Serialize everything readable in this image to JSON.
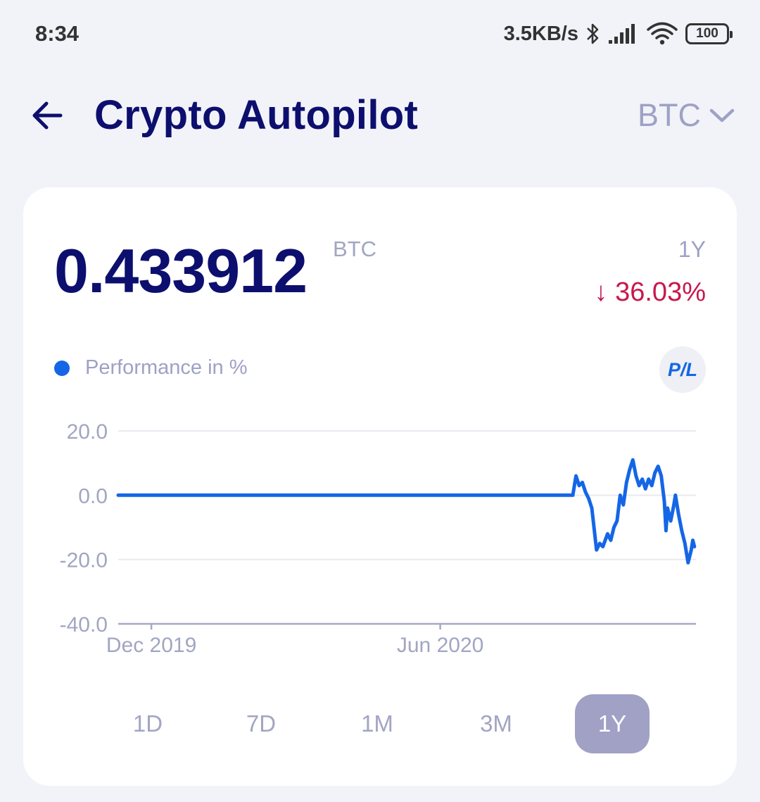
{
  "status_bar": {
    "time": "8:34",
    "net_speed": "3.5KB/s",
    "battery": "100"
  },
  "header": {
    "title": "Crypto Autopilot",
    "asset": "BTC"
  },
  "summary": {
    "balance": "0.433912",
    "balance_unit": "BTC",
    "period": "1Y",
    "change": "↓ 36.03%",
    "change_color": "#c8174d"
  },
  "legend": {
    "label": "Performance in %",
    "color": "#1566e6"
  },
  "pl_button": "P/L",
  "range_buttons": [
    {
      "label": "1D",
      "active": false
    },
    {
      "label": "7D",
      "active": false
    },
    {
      "label": "1M",
      "active": false
    },
    {
      "label": "3M",
      "active": false
    },
    {
      "label": "1Y",
      "active": true
    }
  ],
  "chart_data": {
    "type": "line",
    "title": "",
    "xlabel": "",
    "ylabel": "",
    "ylim": [
      -40,
      20
    ],
    "yticks": [
      "20.0",
      "0.0",
      "-20.0",
      "-40.0"
    ],
    "xticks": [
      "Dec 2019",
      "Jun 2020"
    ],
    "x_range": [
      "2019-11-10",
      "2020-11-10"
    ],
    "grid": true,
    "series": [
      {
        "color": "#1566e6",
        "points": [
          [
            "2019-11-10",
            0
          ],
          [
            "2020-08-24",
            0
          ],
          [
            "2020-08-26",
            6
          ],
          [
            "2020-08-28",
            3
          ],
          [
            "2020-08-30",
            4
          ],
          [
            "2020-09-01",
            1
          ],
          [
            "2020-09-03",
            -1
          ],
          [
            "2020-09-05",
            -4
          ],
          [
            "2020-09-08",
            -17
          ],
          [
            "2020-09-10",
            -15
          ],
          [
            "2020-09-12",
            -16
          ],
          [
            "2020-09-15",
            -12
          ],
          [
            "2020-09-17",
            -14
          ],
          [
            "2020-09-19",
            -10
          ],
          [
            "2020-09-21",
            -8
          ],
          [
            "2020-09-23",
            0
          ],
          [
            "2020-09-25",
            -3
          ],
          [
            "2020-09-27",
            4
          ],
          [
            "2020-09-29",
            8
          ],
          [
            "2020-10-01",
            11
          ],
          [
            "2020-10-03",
            6
          ],
          [
            "2020-10-05",
            3
          ],
          [
            "2020-10-07",
            5
          ],
          [
            "2020-10-09",
            2
          ],
          [
            "2020-10-11",
            5
          ],
          [
            "2020-10-13",
            3
          ],
          [
            "2020-10-15",
            7
          ],
          [
            "2020-10-17",
            9
          ],
          [
            "2020-10-19",
            6
          ],
          [
            "2020-10-21",
            -2
          ],
          [
            "2020-10-22",
            -11
          ],
          [
            "2020-10-23",
            -4
          ],
          [
            "2020-10-25",
            -8
          ],
          [
            "2020-10-27",
            -3
          ],
          [
            "2020-10-28",
            0
          ],
          [
            "2020-10-30",
            -6
          ],
          [
            "2020-11-01",
            -11
          ],
          [
            "2020-11-03",
            -15
          ],
          [
            "2020-11-05",
            -21
          ],
          [
            "2020-11-07",
            -17
          ],
          [
            "2020-11-08",
            -14
          ],
          [
            "2020-11-09",
            -16
          ]
        ]
      }
    ]
  }
}
